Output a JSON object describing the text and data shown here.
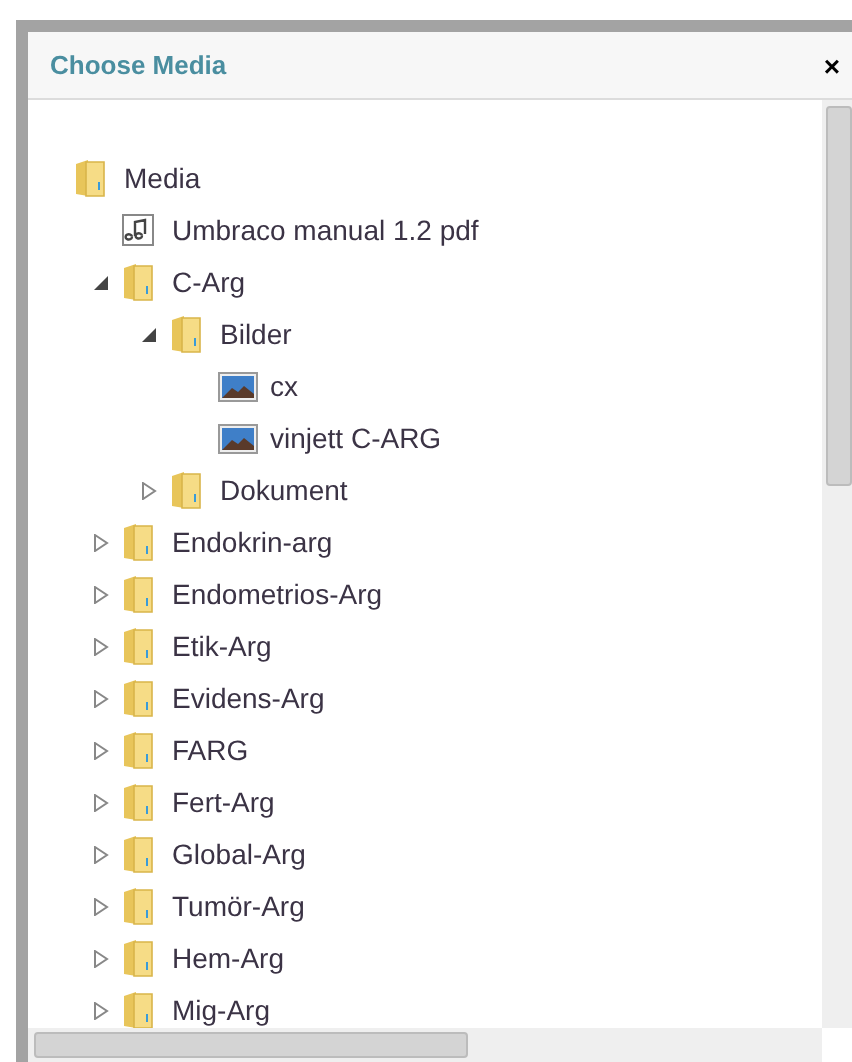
{
  "dialog": {
    "title": "Choose Media",
    "close": "×"
  },
  "tree": [
    {
      "name": "Media",
      "kind": "folder",
      "children": [
        {
          "name": "Umbraco manual 1.2 pdf",
          "kind": "audio"
        },
        {
          "name": "C-Arg",
          "kind": "folder",
          "expanded": true,
          "children": [
            {
              "name": "Bilder",
              "kind": "folder",
              "expanded": true,
              "children": [
                {
                  "name": "cx",
                  "kind": "image"
                },
                {
                  "name": "vinjett C-ARG",
                  "kind": "image"
                }
              ]
            },
            {
              "name": "Dokument",
              "kind": "folder",
              "expanded": false
            }
          ]
        },
        {
          "name": "Endokrin-arg",
          "kind": "folder",
          "expanded": false
        },
        {
          "name": "Endometrios-Arg",
          "kind": "folder",
          "expanded": false
        },
        {
          "name": "Etik-Arg",
          "kind": "folder",
          "expanded": false
        },
        {
          "name": "Evidens-Arg",
          "kind": "folder",
          "expanded": false
        },
        {
          "name": "FARG",
          "kind": "folder",
          "expanded": false
        },
        {
          "name": "Fert-Arg",
          "kind": "folder",
          "expanded": false
        },
        {
          "name": "Global-Arg",
          "kind": "folder",
          "expanded": false
        },
        {
          "name": "Tumör-Arg",
          "kind": "folder",
          "expanded": false
        },
        {
          "name": "Hem-Arg",
          "kind": "folder",
          "expanded": false
        },
        {
          "name": "Mig-Arg",
          "kind": "folder",
          "expanded": false
        }
      ]
    }
  ]
}
